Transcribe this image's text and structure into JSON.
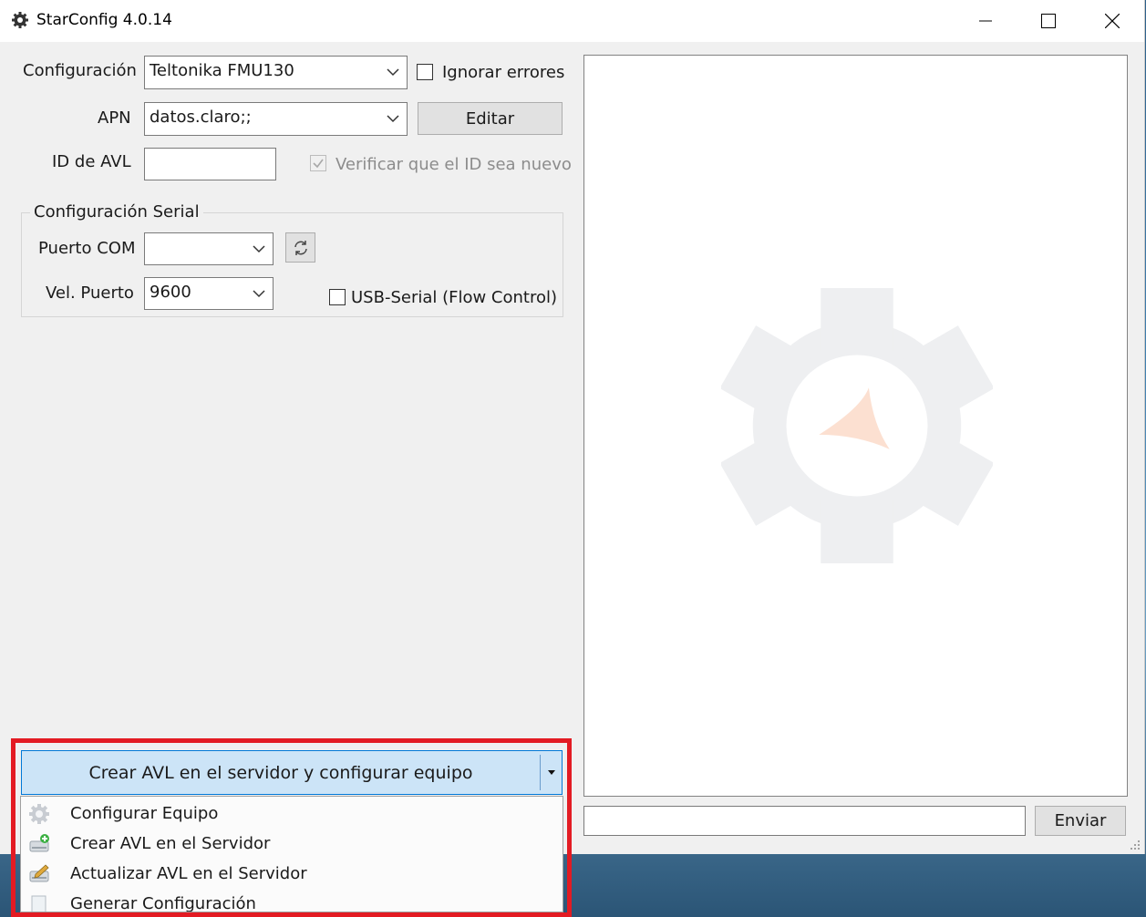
{
  "window": {
    "title": "StarConfig 4.0.14"
  },
  "form": {
    "configuracion_label": "Configuración",
    "configuracion_value": "Teltonika FMU130",
    "ignorar_label": "Ignorar errores",
    "ignorar_checked": false,
    "apn_label": "APN",
    "apn_value": "datos.claro;;",
    "editar_label": "Editar",
    "id_label": "ID de AVL",
    "id_value": "",
    "verificar_label": "Verificar que el ID sea nuevo",
    "verificar_checked": true
  },
  "serial": {
    "group_title": "Configuración Serial",
    "puerto_label": "Puerto COM",
    "puerto_value": "",
    "vel_label": "Vel. Puerto",
    "vel_value": "9600",
    "usb_label": "USB-Serial (Flow Control)",
    "usb_checked": false
  },
  "action": {
    "main_label": "Crear AVL en el servidor y configurar equipo",
    "menu": [
      {
        "label": "Configurar Equipo",
        "icon": "gear-icon"
      },
      {
        "label": "Crear AVL en el Servidor",
        "icon": "add-device-icon"
      },
      {
        "label": "Actualizar AVL en el Servidor",
        "icon": "edit-device-icon"
      },
      {
        "label": "Generar Configuración",
        "icon": "document-icon"
      }
    ]
  },
  "console": {
    "input_value": "",
    "send_label": "Enviar"
  },
  "colors": {
    "accent": "#0078d7",
    "highlight": "#e31b23",
    "logo_triangle": "#f5a77a"
  }
}
